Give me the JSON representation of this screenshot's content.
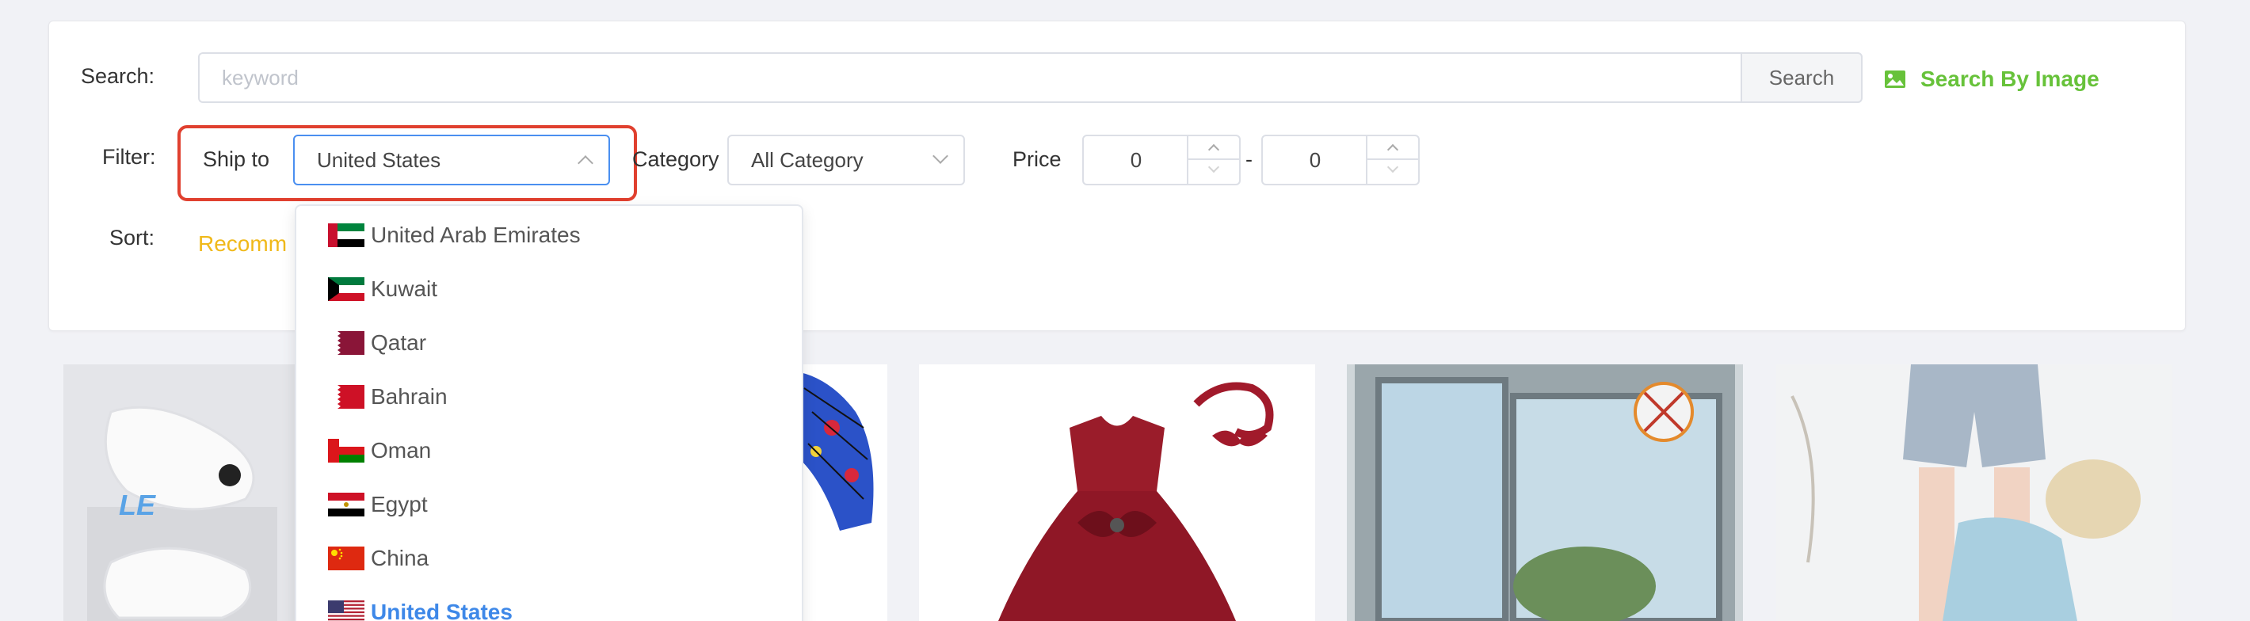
{
  "search": {
    "label": "Search:",
    "placeholder": "keyword",
    "value": "",
    "button_label": "Search",
    "image_search_label": "Search By Image"
  },
  "filter": {
    "label": "Filter:",
    "ship_to_label": "Ship to",
    "ship_to_value": "United States",
    "category_label": "Category",
    "category_value": "All Category",
    "price_label": "Price",
    "price_min": "0",
    "price_max": "0",
    "price_separator": "-"
  },
  "sort": {
    "label": "Sort:",
    "active_option": "Recomm"
  },
  "country_dropdown": {
    "options": [
      {
        "label": "United Arab Emirates",
        "flag": "uae-flag-icon"
      },
      {
        "label": "Kuwait",
        "flag": "kuwait-flag-icon"
      },
      {
        "label": "Qatar",
        "flag": "qatar-flag-icon"
      },
      {
        "label": "Bahrain",
        "flag": "bahrain-flag-icon"
      },
      {
        "label": "Oman",
        "flag": "oman-flag-icon"
      },
      {
        "label": "Egypt",
        "flag": "egypt-flag-icon"
      },
      {
        "label": "China",
        "flag": "china-flag-icon"
      },
      {
        "label": "United States",
        "flag": "us-flag-icon",
        "selected": true
      }
    ]
  },
  "products": [
    {
      "image": "white-sandals-product-image"
    },
    {
      "image": "kids-hoodie-product-image"
    },
    {
      "image": "red-dress-product-image"
    },
    {
      "image": "window-screen-product-image"
    },
    {
      "image": "denim-shorts-product-image"
    }
  ],
  "colors": {
    "accent_blue": "#3e88e8",
    "image_search_green": "#67c23a",
    "sort_active_yellow": "#f0b91a",
    "highlight_red": "#e0402f"
  }
}
